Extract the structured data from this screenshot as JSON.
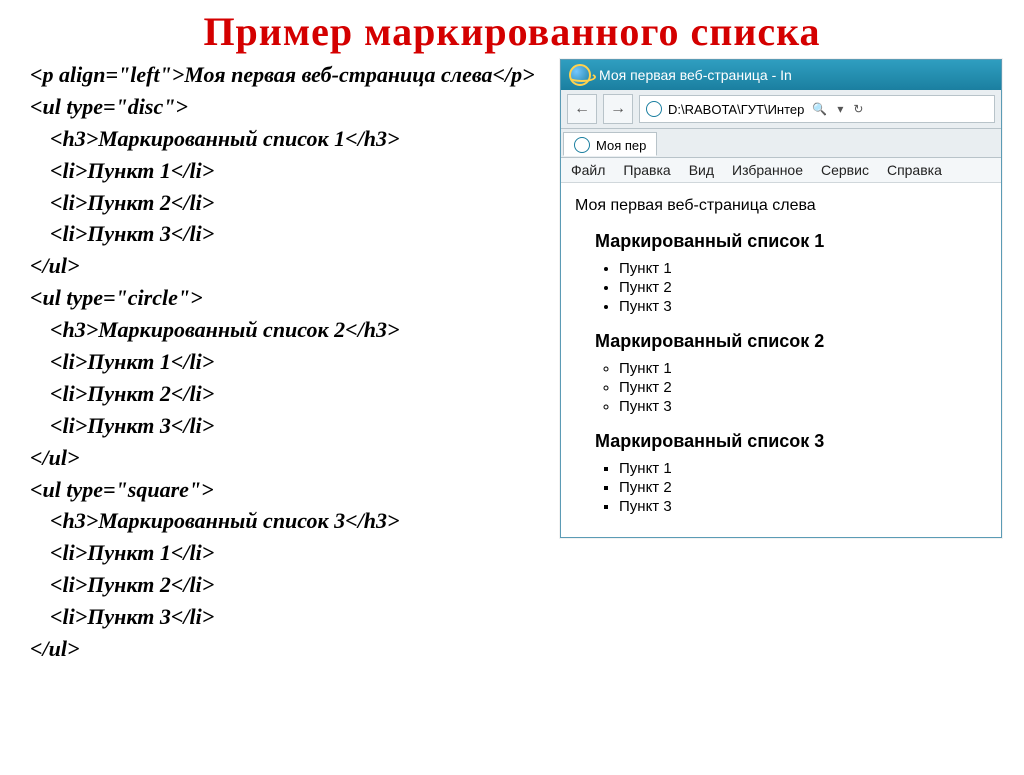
{
  "title": "Пример  маркированного  списка",
  "code": {
    "l1": "<p align=\"left\">Моя первая веб-страница слева</p>",
    "l2": "<ul type=\"disc\">",
    "l3": "<h3>Маркированный список 1</h3>",
    "l4": "<li>Пункт 1</li>",
    "l5": "<li>Пункт 2</li>",
    "l6": "<li>Пункт 3</li>",
    "l7": "</ul>",
    "l8": "<ul type=\"circle\">",
    "l9": "<h3>Маркированный список 2</h3>",
    "l10": "<li>Пункт 1</li>",
    "l11": "<li>Пункт 2</li>",
    "l12": "<li>Пункт 3</li>",
    "l13": "</ul>",
    "l14": "<ul type=\"square\">",
    "l15": "<h3>Маркированный список 3</h3>",
    "l16": "<li>Пункт 1</li>",
    "l17": "<li>Пункт 2</li>",
    "l18": "<li>Пункт 3</li>",
    "l19": "</ul>"
  },
  "browser": {
    "window_title": "Моя первая веб-страница - In",
    "address": "D:\\RABOTA\\ГУТ\\Интер",
    "search_icon": "🔍",
    "refresh_icon": "↻",
    "back_icon": "←",
    "fwd_icon": "→",
    "dropdown_icon": "▾",
    "tab_title": "Моя пер",
    "menu": [
      "Файл",
      "Правка",
      "Вид",
      "Избранное",
      "Сервис",
      "Справка"
    ]
  },
  "page": {
    "paragraph": "Моя первая веб-страница слева",
    "lists": [
      {
        "heading": "Маркированный список 1",
        "type": "disc",
        "items": [
          "Пункт 1",
          "Пункт 2",
          "Пункт 3"
        ]
      },
      {
        "heading": "Маркированный список 2",
        "type": "circle",
        "items": [
          "Пункт 1",
          "Пункт 2",
          "Пункт 3"
        ]
      },
      {
        "heading": "Маркированный список 3",
        "type": "square",
        "items": [
          "Пункт 1",
          "Пункт 2",
          "Пункт 3"
        ]
      }
    ]
  }
}
